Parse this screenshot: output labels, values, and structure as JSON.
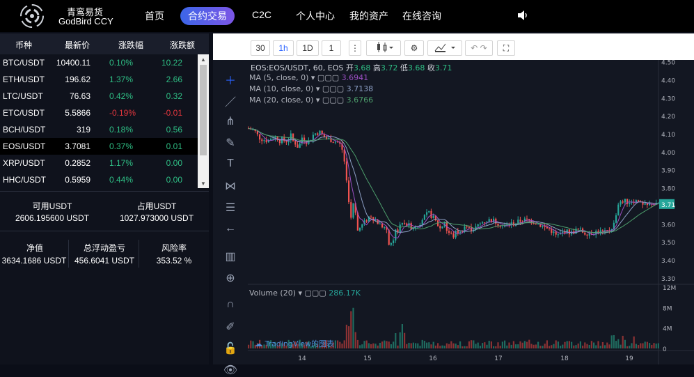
{
  "header": {
    "brand_cn": "青鸾易货",
    "brand_en": "GodBird CCY",
    "nav": [
      "首页",
      "合约交易",
      "C2C",
      "个人中心",
      "我的资产",
      "在线咨询"
    ],
    "active_nav": "合约交易"
  },
  "market": {
    "headers": [
      "币种",
      "最新价",
      "涨跌幅",
      "涨跌额"
    ],
    "rows": [
      {
        "symbol": "BTC/USDT",
        "price": "10400.11",
        "pct": "0.10%",
        "chg": "10.22",
        "dir": "up"
      },
      {
        "symbol": "ETH/USDT",
        "price": "196.62",
        "pct": "1.37%",
        "chg": "2.66",
        "dir": "up"
      },
      {
        "symbol": "LTC/USDT",
        "price": "76.63",
        "pct": "0.42%",
        "chg": "0.32",
        "dir": "up"
      },
      {
        "symbol": "ETC/USDT",
        "price": "5.5866",
        "pct": "-0.19%",
        "chg": "-0.01",
        "dir": "dn"
      },
      {
        "symbol": "BCH/USDT",
        "price": "319",
        "pct": "0.18%",
        "chg": "0.56",
        "dir": "up"
      },
      {
        "symbol": "EOS/USDT",
        "price": "3.7081",
        "pct": "0.37%",
        "chg": "0.01",
        "dir": "up",
        "selected": true
      },
      {
        "symbol": "XRP/USDT",
        "price": "0.2852",
        "pct": "1.17%",
        "chg": "0.00",
        "dir": "up"
      },
      {
        "symbol": "HHC/USDT",
        "price": "0.5959",
        "pct": "0.44%",
        "chg": "0.00",
        "dir": "up"
      }
    ]
  },
  "account": {
    "avail_label": "可用USDT",
    "avail_value": "2606.195600 USDT",
    "used_label": "占用USDT",
    "used_value": "1027.973000 USDT",
    "equity_label": "净值",
    "equity_value": "3634.1686 USDT",
    "pnl_label": "总浮动盈亏",
    "pnl_value": "456.6041 USDT",
    "risk_label": "风险率",
    "risk_value": "353.52 %"
  },
  "chart_toolbar": {
    "intervals": [
      "30",
      "1h",
      "1D",
      "1"
    ],
    "active_interval": "1h"
  },
  "chart": {
    "title": "EOS:EOS/USDT, 60, EOS",
    "ohlc": {
      "open_label": "开",
      "open": "3.68",
      "high_label": "高",
      "high": "3.72",
      "low_label": "低",
      "low": "3.68",
      "close_label": "收",
      "close": "3.71"
    },
    "ma": [
      {
        "label": "MA (5, close, 0)",
        "value": "3.6941",
        "color": "#9c4fc4"
      },
      {
        "label": "MA (10, close, 0)",
        "value": "3.7138",
        "color": "#8ea1c7"
      },
      {
        "label": "MA (20, close, 0)",
        "value": "3.6766",
        "color": "#4d9e6c"
      }
    ],
    "volume_label": "Volume (20)",
    "volume_value": "286.17K",
    "watermark": "TradingView的图表",
    "last_price": "3.71",
    "colors": {
      "up": "#26a69a",
      "down": "#ef5350"
    }
  },
  "chart_data": {
    "type": "candlestick",
    "x_ticks": [
      "14",
      "15",
      "16",
      "17",
      "18",
      "19"
    ],
    "y_ticks": [
      "4.50",
      "4.40",
      "4.30",
      "4.20",
      "4.10",
      "4.00",
      "3.90",
      "3.80",
      "3.70",
      "3.60",
      "3.50",
      "3.40",
      "3.30"
    ],
    "ylim": [
      3.28,
      4.51
    ],
    "vol_ticks": [
      "12M",
      "8M",
      "4M",
      "0"
    ],
    "close_path": [
      [
        0,
        4.13
      ],
      [
        8,
        4.12
      ],
      [
        15,
        4.08
      ],
      [
        20,
        4.07
      ],
      [
        28,
        4.06
      ],
      [
        33,
        4.08
      ],
      [
        37,
        4.08
      ],
      [
        41,
        4.08
      ],
      [
        44,
        4.06
      ],
      [
        47,
        4.07
      ],
      [
        52,
        4.06
      ],
      [
        56,
        4.06
      ],
      [
        59,
        4.08
      ],
      [
        61,
        4.09
      ],
      [
        64,
        4.06
      ],
      [
        67,
        4.05
      ],
      [
        72,
        4.02
      ],
      [
        76,
        4.08
      ],
      [
        78,
        4.08
      ],
      [
        85,
        4.05
      ],
      [
        94,
        4.1
      ],
      [
        102,
        4.11
      ],
      [
        109,
        4.08
      ],
      [
        115,
        4.07
      ],
      [
        123,
        4.06
      ],
      [
        130,
        4.05
      ],
      [
        136,
        4.0
      ],
      [
        148,
        3.6
      ],
      [
        152,
        3.78
      ],
      [
        155,
        3.55
      ],
      [
        158,
        3.57
      ],
      [
        165,
        3.6
      ],
      [
        175,
        3.65
      ],
      [
        182,
        3.62
      ],
      [
        190,
        3.59
      ],
      [
        197,
        3.58
      ],
      [
        203,
        3.47
      ],
      [
        209,
        3.5
      ],
      [
        212,
        3.59
      ],
      [
        215,
        3.55
      ],
      [
        220,
        3.62
      ],
      [
        225,
        3.6
      ],
      [
        236,
        3.58
      ],
      [
        245,
        3.6
      ],
      [
        250,
        3.63
      ],
      [
        259,
        3.66
      ],
      [
        266,
        3.63
      ],
      [
        276,
        3.57
      ],
      [
        282,
        3.62
      ],
      [
        285,
        3.56
      ],
      [
        294,
        3.53
      ],
      [
        299,
        3.56
      ],
      [
        304,
        3.55
      ],
      [
        311,
        3.59
      ],
      [
        318,
        3.57
      ],
      [
        327,
        3.58
      ],
      [
        336,
        3.61
      ],
      [
        343,
        3.62
      ],
      [
        351,
        3.62
      ],
      [
        360,
        3.6
      ],
      [
        367,
        3.58
      ],
      [
        374,
        3.6
      ],
      [
        383,
        3.6
      ],
      [
        391,
        3.62
      ],
      [
        400,
        3.62
      ],
      [
        412,
        3.61
      ],
      [
        425,
        3.58
      ],
      [
        433,
        3.57
      ],
      [
        443,
        3.53
      ],
      [
        454,
        3.56
      ],
      [
        464,
        3.55
      ],
      [
        473,
        3.57
      ],
      [
        483,
        3.55
      ],
      [
        493,
        3.55
      ],
      [
        503,
        3.56
      ],
      [
        511,
        3.55
      ],
      [
        518,
        3.56
      ],
      [
        525,
        3.6
      ],
      [
        531,
        3.7
      ],
      [
        538,
        3.73
      ],
      [
        545,
        3.72
      ],
      [
        552,
        3.73
      ],
      [
        557,
        3.73
      ],
      [
        566,
        3.7
      ],
      [
        575,
        3.7
      ],
      [
        580,
        3.72
      ],
      [
        585,
        3.7
      ],
      [
        590,
        3.72
      ]
    ]
  }
}
